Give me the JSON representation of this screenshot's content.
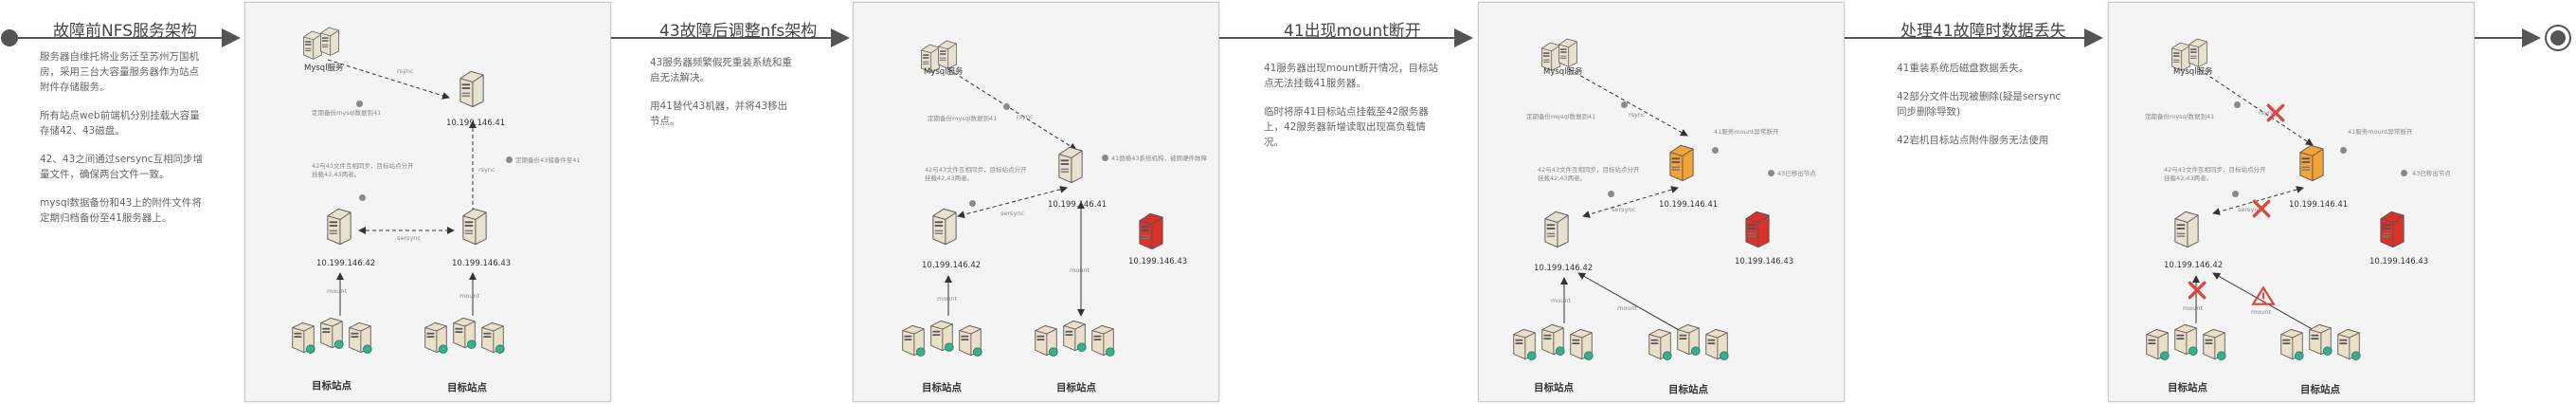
{
  "stages": [
    {
      "title": "故障前NFS服务架构",
      "paragraphs": [
        "服务器自维托将业务迁至苏州万国机房，采用三台大容量服务器作为站点附件存储服务。",
        "所有站点web前端机分别挂载大容量存储42、43磁盘。",
        "42、43之间通过sersync互相同步增量文件，确保两台文件一致。",
        "mysql数据备份和43上的附件文件将定期归档备份至41服务器上。"
      ]
    },
    {
      "title": "43故障后调整nfs架构",
      "paragraphs": [
        "43服务器频繁假死重装系统和重启无法解决。",
        "用41替代43机器，并将43移出节点。"
      ]
    },
    {
      "title": "41出现mount断开",
      "paragraphs": [
        "41服务器出现mount断开情况，目标站点无法挂载41服务器。",
        "临时将原41目标站点挂载至42服务器上，42服务器新增读取出现高负载情况。"
      ]
    },
    {
      "title": "处理41故障时数据丢失",
      "paragraphs": [
        "41重装系统后磁盘数据丢失。",
        "42部分文件出现被删除(疑是sersync同步删除导致)",
        "42岩机目标站点附件服务无法使用"
      ]
    }
  ],
  "diagrams": [
    {
      "mysql": "Mysql服务",
      "rsync": "rsync",
      "mysql_note": "定期备份mysql数据到41",
      "server41": "10.199.146.41",
      "archive_note": "定期备份43储备件至41",
      "server42": "10.199.146.42",
      "server43": "10.199.146.43",
      "sync_note": "42与43文件互相同步，目标站点分开挂载42,43两者。",
      "sersync": "sersync",
      "mount": "mount",
      "site_left": "目标站点",
      "site_right": "目标站点"
    },
    {
      "mysql": "Mysql服务",
      "rsync": "rsync",
      "mysql_note": "定期备份mysql数据到41",
      "server41": "10.199.146.41",
      "replace_note": "41替换43系统机构，被原硬件故障",
      "server42": "10.199.146.42",
      "server43": "10.199.146.43",
      "sync_note": "42与43文件互相同步，目标站点分开挂载42,43两者。",
      "sersync": "sersync",
      "mount": "mount",
      "site_left": "目标站点",
      "site_right": "目标站点"
    },
    {
      "mysql": "Mysql服务",
      "rsync": "rsync",
      "mysql_note": "定期备份mysql数据到41",
      "server41": "10.199.146.41",
      "mount_fail_note": "41服务mount异常断开",
      "server42": "10.199.146.42",
      "server43": "10.199.146.43",
      "removed_note": "43已移出节点",
      "sync_note": "42与43文件互相同步，目标站点分开挂载42,43两者。",
      "sersync": "sersync",
      "mount": "mount",
      "site_left": "目标站点",
      "site_right": "目标站点"
    },
    {
      "mysql": "Mysql服务",
      "rsync": "rsync",
      "mysql_note": "定期备份mysql数据到41",
      "server41": "10.199.146.41",
      "mount_fail_note": "41服务mount异常断开",
      "server42": "10.199.146.42",
      "server43": "10.199.146.43",
      "removed_note": "43已移出节点",
      "sync_note": "42与43文件互相同步，目标站点分开挂载42,43两者。",
      "sersync": "sersync",
      "mount": "mount",
      "site_left": "目标站点",
      "site_right": "目标站点"
    }
  ],
  "colors": {
    "line": "#555555",
    "server_normal": "#e9e1cf",
    "server_warning": "#f2a33a",
    "server_failed": "#d8322b",
    "error_mark": "#e0443a",
    "panel_bg": "#f4f4f4"
  }
}
